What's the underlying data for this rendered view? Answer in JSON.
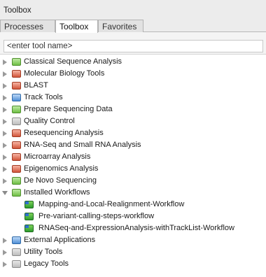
{
  "panel": {
    "title": "Toolbox"
  },
  "tabs": [
    {
      "label": "Processes",
      "active": false
    },
    {
      "label": "Toolbox",
      "active": true
    },
    {
      "label": "Favorites",
      "active": false
    }
  ],
  "search": {
    "value": "<enter tool name>"
  },
  "tree": [
    {
      "label": "Classical Sequence Analysis",
      "expanded": false,
      "icon": "classical-sequence-analysis-icon"
    },
    {
      "label": "Molecular Biology Tools",
      "expanded": false,
      "icon": "molecular-biology-icon"
    },
    {
      "label": "BLAST",
      "expanded": false,
      "icon": "blast-icon"
    },
    {
      "label": "Track Tools",
      "expanded": false,
      "icon": "track-tools-icon"
    },
    {
      "label": "Prepare Sequencing Data",
      "expanded": false,
      "icon": "prepare-sequencing-icon"
    },
    {
      "label": "Quality Control",
      "expanded": false,
      "icon": "quality-control-icon"
    },
    {
      "label": "Resequencing Analysis",
      "expanded": false,
      "icon": "resequencing-icon"
    },
    {
      "label": "RNA-Seq and Small RNA Analysis",
      "expanded": false,
      "icon": "rna-seq-icon"
    },
    {
      "label": "Microarray Analysis",
      "expanded": false,
      "icon": "microarray-icon"
    },
    {
      "label": "Epigenomics Analysis",
      "expanded": false,
      "icon": "epigenomics-icon"
    },
    {
      "label": "De Novo Sequencing",
      "expanded": false,
      "icon": "de-novo-icon"
    },
    {
      "label": "Installed Workflows",
      "expanded": true,
      "icon": "workflows-folder-icon",
      "children": [
        {
          "label": "Mapping-and-Local-Realignment-Workflow",
          "icon": "workflow-icon"
        },
        {
          "label": "Pre-variant-calling-steps-workflow",
          "icon": "workflow-icon"
        },
        {
          "label": "RNASeq-and-ExpressionAnalysis-withTrackList-Workflow",
          "icon": "workflow-icon"
        }
      ]
    },
    {
      "label": "External Applications",
      "expanded": false,
      "icon": "external-applications-icon"
    },
    {
      "label": "Utility Tools",
      "expanded": false,
      "icon": "utility-tools-icon"
    },
    {
      "label": "Legacy Tools",
      "expanded": false,
      "icon": "legacy-tools-icon"
    }
  ]
}
